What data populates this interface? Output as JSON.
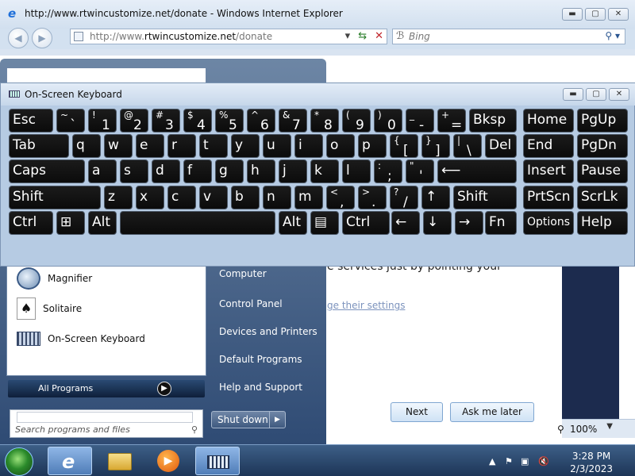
{
  "browser": {
    "title": "http://www.rtwincustomize.net/donate - Windows Internet Explorer",
    "url_prefix": "http://www.",
    "url_domain": "rtwincustomize.net",
    "url_path": "/donate",
    "search_placeholder": "Bing",
    "zoom": "100%"
  },
  "page": {
    "text_fragment": "e services just by pointing your",
    "link_fragment": "ge their settings",
    "next_button": "Next",
    "ask_later_button": "Ask me later"
  },
  "start_menu": {
    "programs": [
      {
        "label": "Magnifier",
        "icon": "magnifier-icon"
      },
      {
        "label": "Solitaire",
        "icon": "solitaire-icon"
      },
      {
        "label": "On-Screen Keyboard",
        "icon": "keyboard-icon"
      }
    ],
    "all_programs": "All Programs",
    "search_placeholder": "Search programs and files",
    "right_items": [
      "Computer",
      "Control Panel",
      "Devices and Printers",
      "Default Programs",
      "Help and Support"
    ],
    "shutdown_label": "Shut down"
  },
  "osk": {
    "title": "On-Screen Keyboard",
    "rows": [
      [
        {
          "l": "Esc"
        },
        {
          "u": "~",
          "d": "`"
        },
        {
          "u": "!",
          "d": "1"
        },
        {
          "u": "@",
          "d": "2"
        },
        {
          "u": "#",
          "d": "3"
        },
        {
          "u": "$",
          "d": "4"
        },
        {
          "u": "%",
          "d": "5"
        },
        {
          "u": "^",
          "d": "6"
        },
        {
          "u": "&",
          "d": "7"
        },
        {
          "u": "*",
          "d": "8"
        },
        {
          "u": "(",
          "d": "9"
        },
        {
          "u": ")",
          "d": "0"
        },
        {
          "u": "_",
          "d": "-"
        },
        {
          "u": "+",
          "d": "="
        },
        {
          "l": "Bksp"
        },
        {
          "l": "Home"
        },
        {
          "l": "PgUp"
        }
      ],
      [
        {
          "l": "Tab"
        },
        {
          "l": "q"
        },
        {
          "l": "w"
        },
        {
          "l": "e"
        },
        {
          "l": "r"
        },
        {
          "l": "t"
        },
        {
          "l": "y"
        },
        {
          "l": "u"
        },
        {
          "l": "i"
        },
        {
          "l": "o"
        },
        {
          "l": "p"
        },
        {
          "u": "{",
          "d": "["
        },
        {
          "u": "}",
          "d": "]"
        },
        {
          "u": "|",
          "d": "\\"
        },
        {
          "l": "Del"
        },
        {
          "l": "End"
        },
        {
          "l": "PgDn"
        }
      ],
      [
        {
          "l": "Caps"
        },
        {
          "l": "a"
        },
        {
          "l": "s"
        },
        {
          "l": "d"
        },
        {
          "l": "f"
        },
        {
          "l": "g"
        },
        {
          "l": "h"
        },
        {
          "l": "j"
        },
        {
          "l": "k"
        },
        {
          "l": "l"
        },
        {
          "u": ":",
          "d": ";"
        },
        {
          "u": "\"",
          "d": "'"
        },
        {
          "l": "⟵"
        },
        {
          "l": "Insert"
        },
        {
          "l": "Pause"
        }
      ],
      [
        {
          "l": "Shift"
        },
        {
          "l": "z"
        },
        {
          "l": "x"
        },
        {
          "l": "c"
        },
        {
          "l": "v"
        },
        {
          "l": "b"
        },
        {
          "l": "n"
        },
        {
          "l": "m"
        },
        {
          "u": "<",
          "d": ","
        },
        {
          "u": ">",
          "d": "."
        },
        {
          "u": "?",
          "d": "/"
        },
        {
          "l": "↑"
        },
        {
          "l": "Shift"
        },
        {
          "l": "PrtScn"
        },
        {
          "l": "ScrLk"
        }
      ],
      [
        {
          "l": "Ctrl"
        },
        {
          "l": "⊞"
        },
        {
          "l": "Alt"
        },
        {
          "l": ""
        },
        {
          "l": "Alt"
        },
        {
          "l": "▤"
        },
        {
          "l": "Ctrl"
        },
        {
          "l": "←"
        },
        {
          "l": "↓"
        },
        {
          "l": "→"
        },
        {
          "l": "Fn"
        },
        {
          "l": "Options"
        },
        {
          "l": "Help"
        }
      ]
    ]
  },
  "taskbar": {
    "time": "3:28 PM",
    "date": "2/3/2023",
    "pinned": [
      "internet-explorer-icon",
      "windows-explorer-icon",
      "media-player-icon",
      "on-screen-keyboard-icon"
    ]
  },
  "colors": {
    "key_bg": "#111111",
    "taskbar": "#1d3557",
    "start_menu": "#2f4b74"
  }
}
